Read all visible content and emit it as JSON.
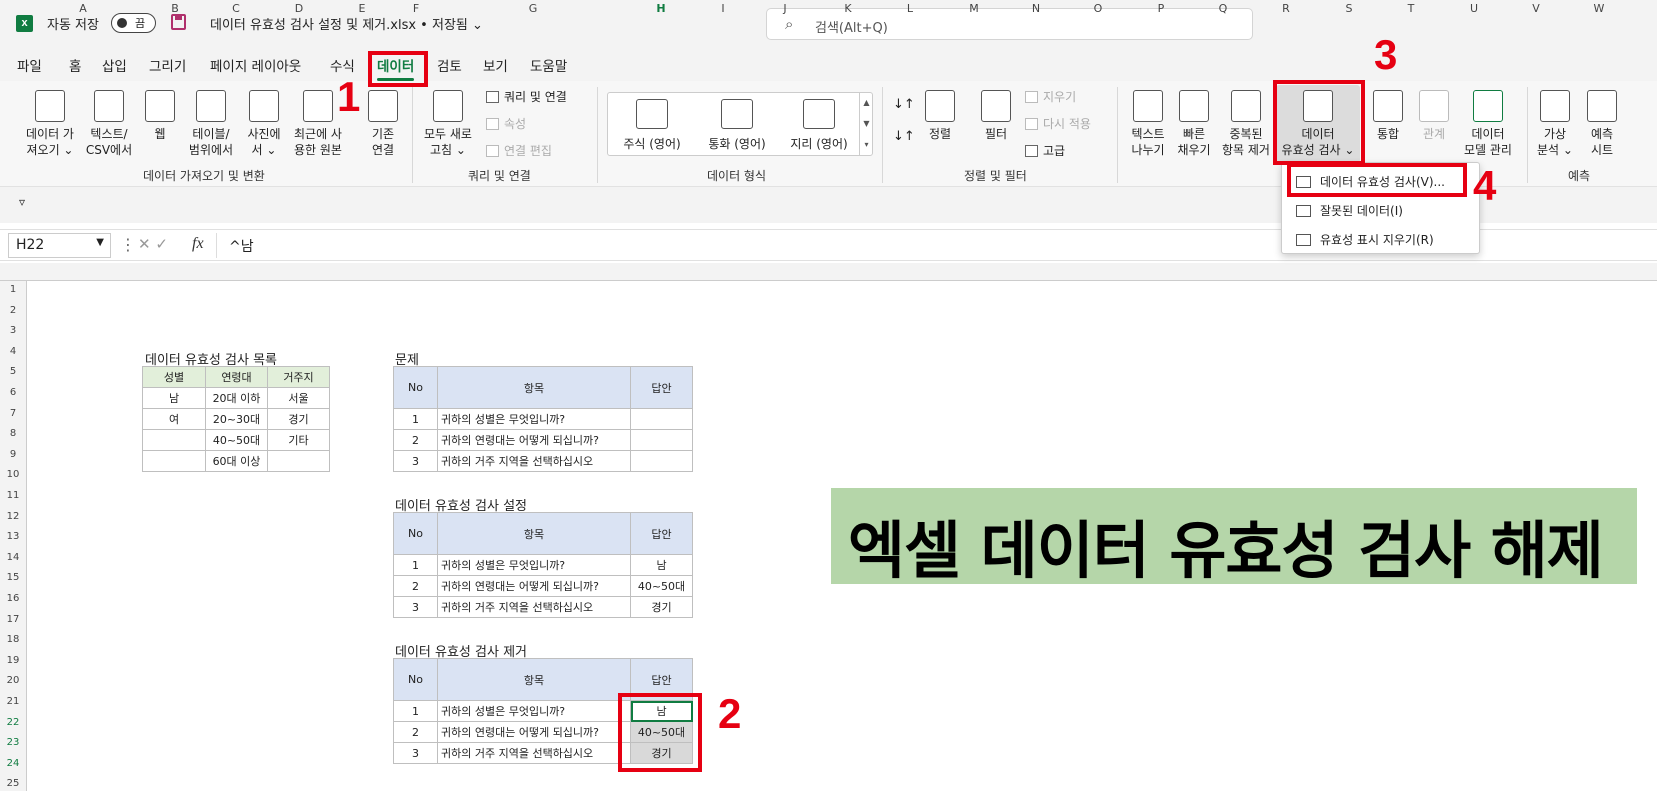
{
  "titlebar": {
    "autosave_label": "자동 저장",
    "autosave_state": "끔",
    "filename": "데이터 유효성 검사 설정 및 제거.xlsx • 저장됨 ⌄",
    "search_placeholder": "검색(Alt+Q)"
  },
  "menu": [
    "파일",
    "홈",
    "삽입",
    "그리기",
    "페이지 레이아웃",
    "수식",
    "데이터",
    "검토",
    "보기",
    "도움말"
  ],
  "ribbon": {
    "get_data": "데이터 가\n져오기 ⌄",
    "text_csv": "텍스트/\nCSV에서",
    "web": "웹",
    "table_range": "테이블/\n범위에서",
    "from_picture": "사진에\n서 ⌄",
    "recent_sources": "최근에 사\n용한 원본",
    "existing_conn": "기존\n연결",
    "group_get": "데이터 가져오기 및 변환",
    "refresh_all": "모두 새로\n고침 ⌄",
    "queries_conn": "쿼리 및 연결",
    "properties": "속성",
    "edit_links": "연결 편집",
    "group_queries": "쿼리 및 연결",
    "stocks": "주식 (영어)",
    "currencies": "통화 (영어)",
    "geography": "지리 (영어)",
    "group_types": "데이터 형식",
    "sort": "정렬",
    "filter": "필터",
    "clear": "지우기",
    "reapply": "다시 적용",
    "advanced": "고급",
    "group_sort": "정렬 및 필터",
    "text_to_columns": "텍스트\n나누기",
    "flash_fill": "빠른\n채우기",
    "remove_dup": "중복된\n항목 제거",
    "data_validation": "데이터\n유효성 검사 ⌄",
    "consolidate": "통합",
    "relationships": "관계",
    "data_model": "데이터\n모델 관리",
    "whatif": "가상\n분석 ⌄",
    "forecast_sheet": "예측\n시트",
    "group_forecast": "예측"
  },
  "dropdown": [
    "데이터 유효성 검사(V)...",
    "잘못된 데이터(I)",
    "유효성 표시 지우기(R)"
  ],
  "annotations": [
    "1",
    "2",
    "3",
    "4"
  ],
  "formula_bar": {
    "cell": "H22",
    "formula": "^남",
    "fx": "fx"
  },
  "columns": [
    "A",
    "B",
    "C",
    "D",
    "E",
    "F",
    "G",
    "H",
    "I",
    "J",
    "K",
    "L",
    "M",
    "N",
    "O",
    "P",
    "Q",
    "R",
    "S",
    "T",
    "U",
    "V",
    "W"
  ],
  "rows": [
    "1",
    "2",
    "3",
    "4",
    "5",
    "6",
    "7",
    "8",
    "9",
    "10",
    "11",
    "12",
    "13",
    "14",
    "15",
    "16",
    "17",
    "18",
    "19",
    "20",
    "21",
    "22",
    "23",
    "24",
    "25"
  ],
  "list_title": "데이터 유효성 검사 목록",
  "list_header": [
    "성별",
    "연령대",
    "거주지"
  ],
  "list_rows": [
    [
      "남",
      "20대 이하",
      "서울"
    ],
    [
      "여",
      "20~30대",
      "경기"
    ],
    [
      "",
      "40~50대",
      "기타"
    ],
    [
      "",
      "60대 이상",
      ""
    ]
  ],
  "q_header": [
    "No",
    "항목",
    "답안"
  ],
  "tables": [
    {
      "title": "문제",
      "rows": [
        [
          "1",
          "귀하의 성별은 무엇입니까?",
          ""
        ],
        [
          "2",
          "귀하의 연령대는 어떻게 되십니까?",
          ""
        ],
        [
          "3",
          "귀하의 거주 지역을 선택하십시오",
          ""
        ]
      ]
    },
    {
      "title": "데이터 유효성 검사 설정",
      "rows": [
        [
          "1",
          "귀하의 성별은 무엇입니까?",
          "남"
        ],
        [
          "2",
          "귀하의 연령대는 어떻게 되십니까?",
          "40~50대"
        ],
        [
          "3",
          "귀하의 거주 지역을 선택하십시오",
          "경기"
        ]
      ]
    },
    {
      "title": "데이터 유효성 검사 제거",
      "rows": [
        [
          "1",
          "귀하의 성별은 무엇입니까?",
          "남"
        ],
        [
          "2",
          "귀하의 연령대는 어떻게 되십니까?",
          "40~50대"
        ],
        [
          "3",
          "귀하의 거주 지역을 선택하십시오",
          "경기"
        ]
      ]
    }
  ],
  "banner": "엑셀 데이터 유효성 검사 해제",
  "colors": {
    "excel_green": "#107c41",
    "highlight_red": "#e60012",
    "banner_bg": "#b5d6a9",
    "table_header": "#dae3f3",
    "list_header": "#e2efda"
  }
}
